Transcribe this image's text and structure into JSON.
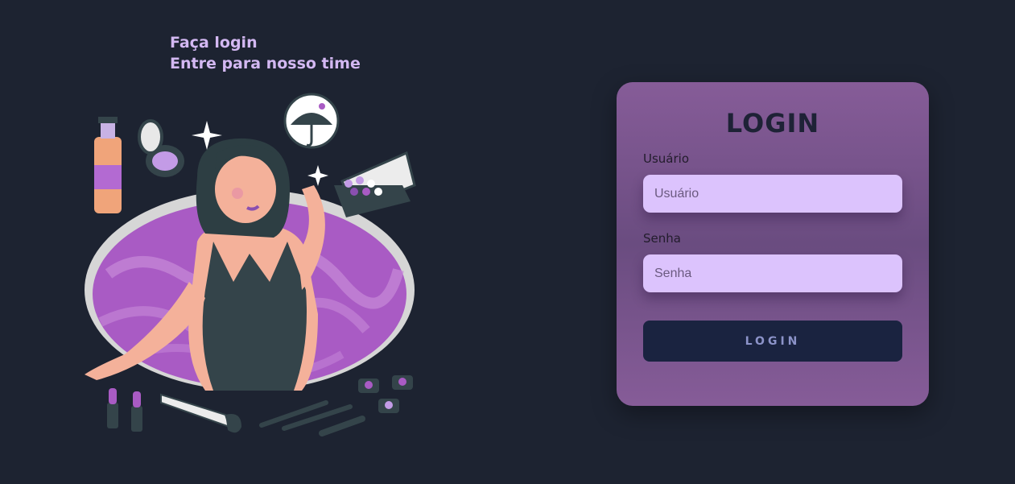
{
  "header": {
    "line1": "Faça login",
    "line2": "Entre para nosso time"
  },
  "illustration": {
    "icon": "woman-in-bath-with-makeup-illustration"
  },
  "login_card": {
    "title": "LOGIN",
    "username": {
      "label": "Usuário",
      "placeholder": "Usuário",
      "value": ""
    },
    "password": {
      "label": "Senha",
      "placeholder": "Senha",
      "value": ""
    },
    "submit_label": "LOGIN"
  },
  "colors": {
    "background": "#1d2331",
    "accent_text": "#d3b8f2",
    "card": "#865c98",
    "input_bg": "#dcc3fd",
    "button_bg": "#1a2340"
  }
}
